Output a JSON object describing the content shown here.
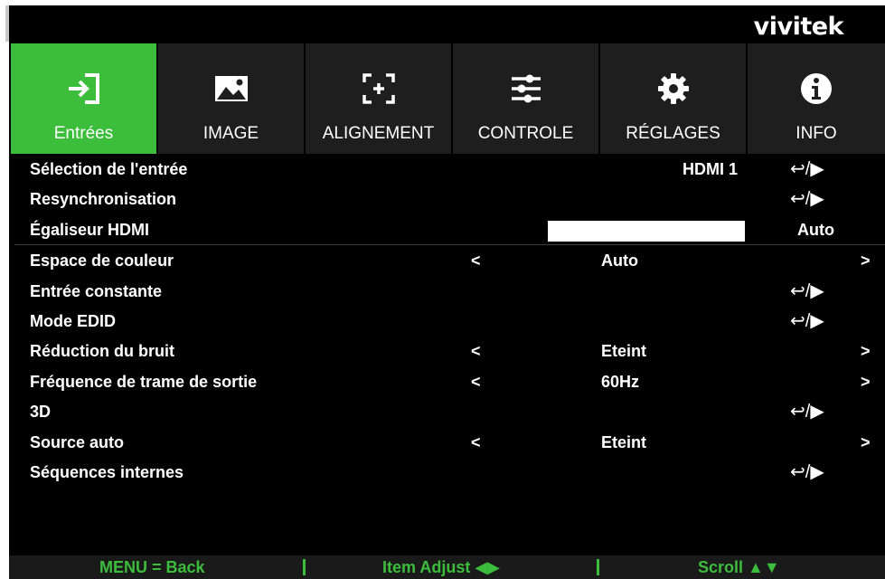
{
  "brand": {
    "logo_text": "vivitek"
  },
  "tabs": [
    {
      "label": "Entrées",
      "icon": "input-icon",
      "active": true
    },
    {
      "label": "IMAGE",
      "icon": "image-icon",
      "active": false
    },
    {
      "label": "ALIGNEMENT",
      "icon": "alignment-icon",
      "active": false
    },
    {
      "label": "CONTROLE",
      "icon": "sliders-icon",
      "active": false
    },
    {
      "label": "RÉGLAGES",
      "icon": "gear-icon",
      "active": false
    },
    {
      "label": "INFO",
      "icon": "info-icon",
      "active": false
    }
  ],
  "rows": [
    {
      "label": "Sélection de l'entrée",
      "value": "HDMI 1",
      "enter": "↩/▶"
    },
    {
      "label": "Resynchronisation",
      "enter": "↩/▶"
    },
    {
      "label": "Égaliseur HDMI",
      "value": "Auto"
    },
    {
      "label": "Espace de couleur",
      "left": "<",
      "value": "Auto",
      "right": ">"
    },
    {
      "label": "Entrée constante",
      "enter": "↩/▶"
    },
    {
      "label": "Mode EDID",
      "enter": "↩/▶"
    },
    {
      "label": "Réduction du bruit",
      "left": "<",
      "value": "Eteint",
      "right": ">"
    },
    {
      "label": "Fréquence de trame de sortie",
      "left": "<",
      "value": "60Hz",
      "right": ">"
    },
    {
      "label": "3D",
      "enter": "↩/▶"
    },
    {
      "label": "Source auto",
      "left": "<",
      "value": "Eteint",
      "right": ">"
    },
    {
      "label": "Séquences internes",
      "enter": "↩/▶"
    }
  ],
  "footer": {
    "menu_back": "MENU = Back",
    "item_adjust": "Item Adjust ◀▶",
    "scroll": "Scroll ▲▼"
  },
  "colors": {
    "accent": "#3cbe3c",
    "background": "#000000",
    "tab_inactive": "#1e1e1e"
  }
}
